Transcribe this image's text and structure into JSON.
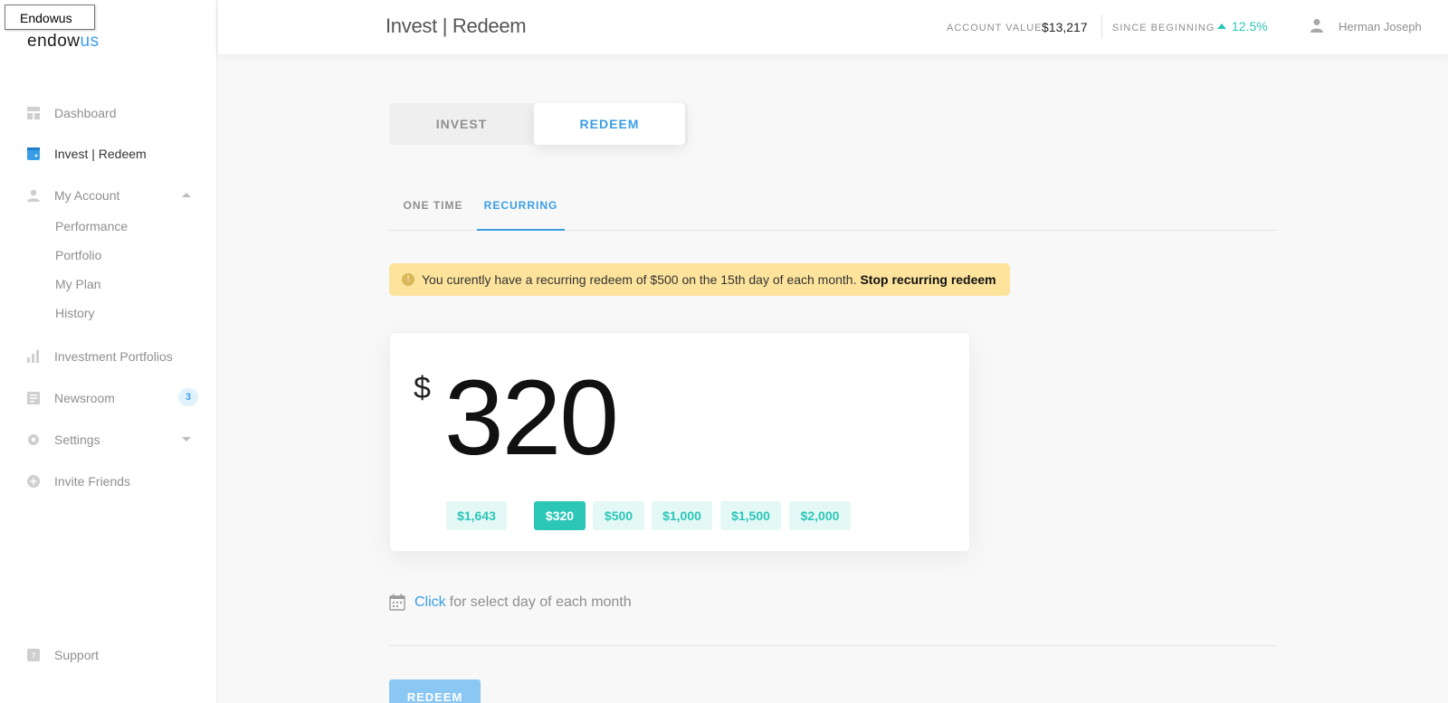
{
  "tooltip": "Endowus",
  "brand": {
    "logo_main": "endow",
    "logo_accent": "us"
  },
  "sidebar": {
    "items": [
      {
        "label": "Dashboard",
        "icon": "dashboard-icon"
      },
      {
        "label": "Invest | Redeem",
        "icon": "wallet-icon"
      },
      {
        "label": "My Account",
        "icon": "person-icon"
      },
      {
        "label": "Investment Portfolios",
        "icon": "bar-chart-icon"
      },
      {
        "label": "Newsroom",
        "icon": "newspaper-icon",
        "badge": "3"
      },
      {
        "label": "Settings",
        "icon": "gear-icon"
      },
      {
        "label": "Invite Friends",
        "icon": "plus-circle-icon"
      },
      {
        "label": "Support",
        "icon": "help-icon"
      }
    ],
    "account_sub": [
      "Performance",
      "Portfolio",
      "My Plan",
      "History"
    ]
  },
  "header": {
    "title": "Invest | Redeem",
    "account_value_label": "ACCOUNT VALUE",
    "account_value": "$13,217",
    "since_label": "SINCE BEGINNING",
    "since_value": "12.5%",
    "user_name": "Herman Joseph"
  },
  "main": {
    "segment": {
      "invest": "INVEST",
      "redeem": "REDEEM",
      "selected": "REDEEM"
    },
    "tabs": {
      "one_time": "ONE TIME",
      "recurring": "RECURRING",
      "selected": "RECURRING"
    },
    "alert": {
      "message": "You curently have a recurring redeem of $500 on the 15th day of each month.",
      "action": "Stop recurring redeem"
    },
    "amount": {
      "currency": "$",
      "value": "320"
    },
    "chips": [
      "$1,643",
      "$320",
      "$500",
      "$1,000",
      "$1,500",
      "$2,000"
    ],
    "selected_chip": "$320",
    "schedule": {
      "link": "Click",
      "text": "for select day of each month"
    },
    "submit": "REDEEM"
  },
  "colors": {
    "accent_blue": "#3a9ee6",
    "teal": "#2cc6b7",
    "alert_yellow": "#fde39c",
    "disabled_button": "#8ac7f2"
  }
}
